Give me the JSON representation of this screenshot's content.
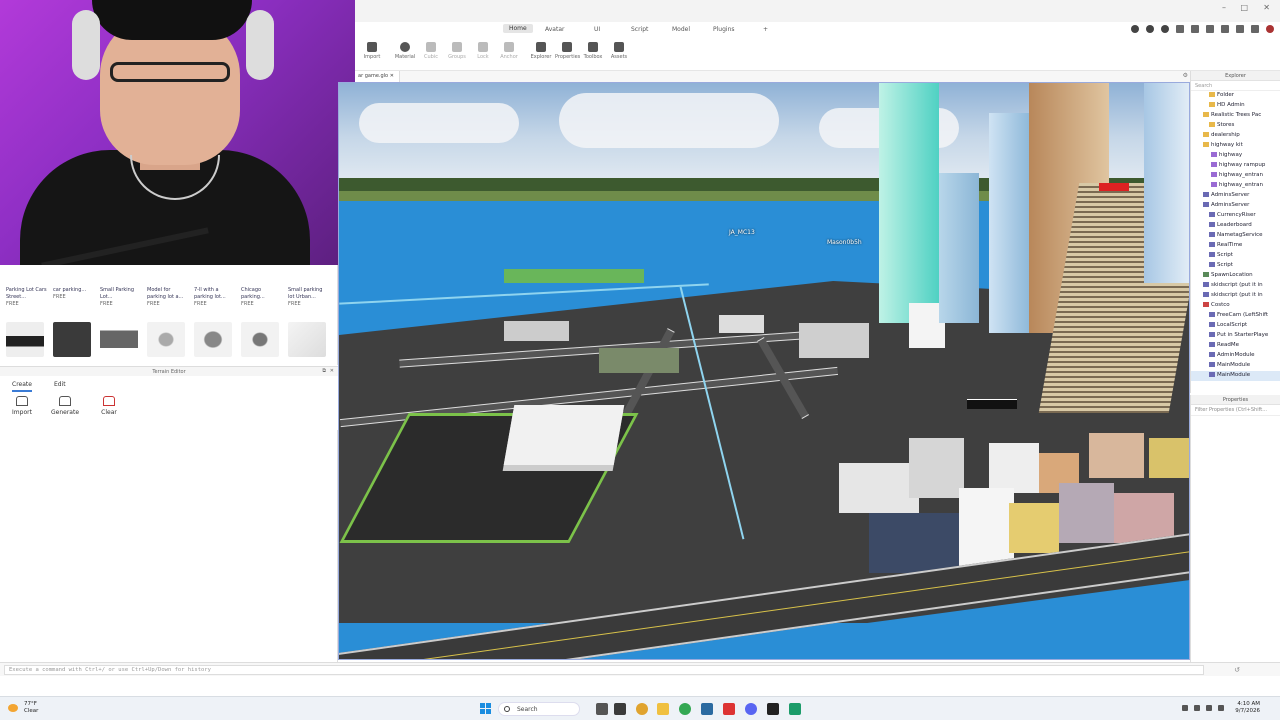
{
  "menu": {
    "tabs": [
      "Home",
      "Avatar",
      "UI",
      "Script",
      "Model",
      "Plugins"
    ],
    "active_tab": "Home"
  },
  "ribbon": {
    "buttons": [
      "Import",
      "Material",
      "Cubic",
      "Groups",
      "Lock",
      "Anchor",
      "Explorer",
      "Properties",
      "Toolbox",
      "Assets"
    ]
  },
  "doc_tab": {
    "label": "ar game.glo"
  },
  "viewport": {
    "player_tags": [
      "JA_MC13",
      "Mason0b5h"
    ]
  },
  "toolbox": {
    "items": [
      {
        "title": "Parking Lot Cars Street...",
        "price": "FREE"
      },
      {
        "title": "car parking...",
        "price": "FREE"
      },
      {
        "title": "Small Parking Lot...",
        "price": "FREE"
      },
      {
        "title": "Model for parking lot a...",
        "price": "FREE"
      },
      {
        "title": "7-ll with a parking lot...",
        "price": "FREE"
      },
      {
        "title": "Chicago parking...",
        "price": "FREE"
      },
      {
        "title": "Small parking lot Urban...",
        "price": "FREE"
      }
    ]
  },
  "terrain": {
    "title": "Terrain Editor",
    "tabs": [
      "Create",
      "Edit"
    ],
    "active_tab": "Create",
    "buttons": [
      "Import",
      "Generate",
      "Clear"
    ]
  },
  "explorer": {
    "title": "Explorer",
    "search_placeholder": "Search",
    "items": [
      "Folder",
      "HD Admin",
      "Realistic Trees Pac",
      "Stores",
      "dealership",
      "highway kit",
      "highway",
      "highway rampup",
      "highway_entran",
      "highway_entran",
      "AdminsServer",
      "AdminsServer",
      "CurrencyRiser",
      "Leaderboard",
      "NametagService",
      "RealTime",
      "Script",
      "Script",
      "SpawnLocation",
      "skidscript (put it in",
      "skidscript (put it in",
      "Costco",
      "FreeCam (LeftShift",
      "LocalScript",
      "Put in StarterPlaye",
      "ReadMe",
      "AdminModule",
      "MainModule",
      "MainModule"
    ]
  },
  "properties": {
    "title": "Properties",
    "filter_placeholder": "Filter Properties (Ctrl+Shift..."
  },
  "command_bar": {
    "placeholder": "Execute a command with Ctrl+/ or use Ctrl+Up/Down for history"
  },
  "taskbar": {
    "weather_temp": "77°F",
    "weather_desc": "Clear",
    "search_label": "Search",
    "time": "4:10 AM",
    "date": "9/7/2026"
  }
}
